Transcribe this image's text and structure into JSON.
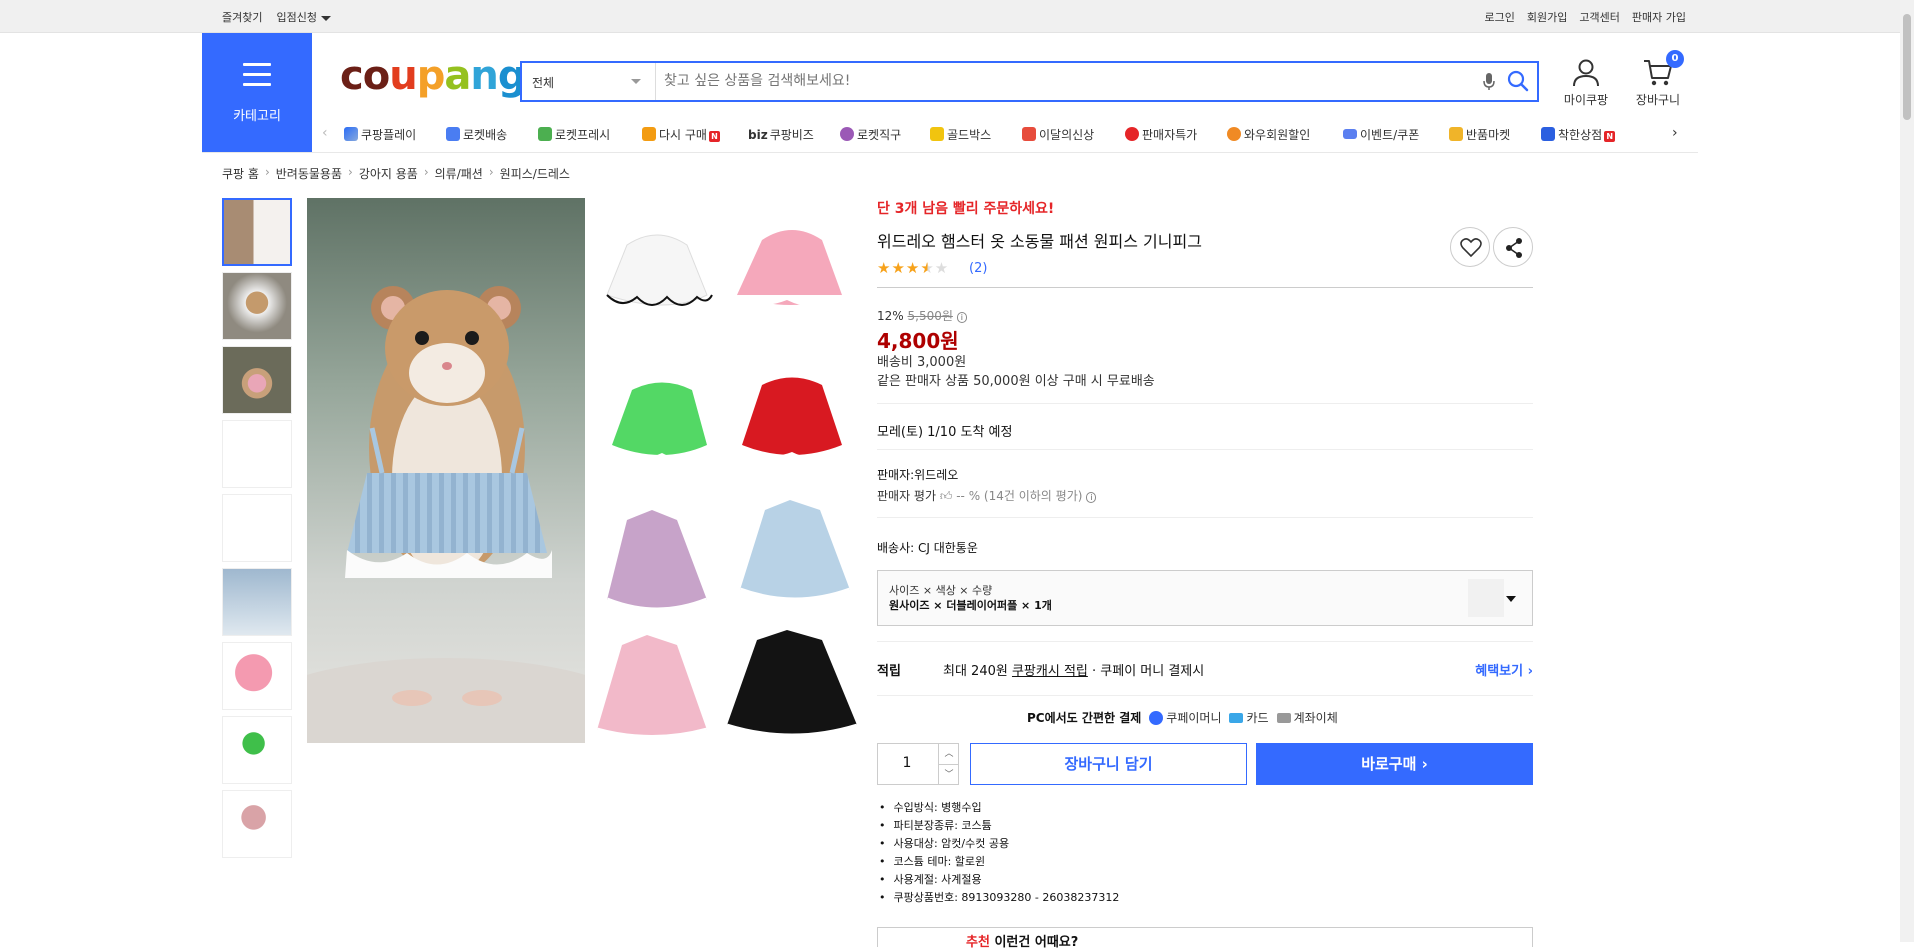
{
  "topbar": {
    "left": [
      "즐겨찾기",
      "입점신청"
    ],
    "right": [
      "로그인",
      "회원가입",
      "고객센터",
      "판매자 가입"
    ]
  },
  "category_label": "카테고리",
  "logo": [
    "c",
    "o",
    "u",
    "p",
    "a",
    "n",
    "g"
  ],
  "search": {
    "category": "전체",
    "placeholder": "찾고 싶은 상품을 검색해보세요!"
  },
  "header_actions": {
    "mycoupang": "마이쿠팡",
    "cart": "장바구니",
    "cart_count": "0"
  },
  "shortcuts": [
    "쿠팡플레이",
    "로켓배송",
    "로켓프레시",
    "다시 구매",
    "쿠팡비즈",
    "로켓직구",
    "골드박스",
    "이달의신상",
    "판매자특가",
    "와우회원할인",
    "이벤트/쿠폰",
    "반품마켓",
    "착한상점"
  ],
  "biz_prefix": "biz",
  "breadcrumb": [
    "쿠팡 홈",
    "반려동물용품",
    "강아지 용품",
    "의류/패션",
    "원피스/드레스"
  ],
  "product": {
    "low_stock": "단 3개 남음 빨리 주문하세요!",
    "title": "위드레오 햄스터 옷 소동물 패션 원피스 기니피그",
    "rating": 3.5,
    "review_count": "(2)",
    "discount": "12%",
    "original_price": "5,500원",
    "price": "4,800원",
    "shipping_fee": "배송비 3,000원",
    "free_shipping": "같은 판매자 상품 50,000원 이상 구매 시 무료배송",
    "arrival": "모레(토) 1/10 도착 예정",
    "seller": "판매자:위드레오",
    "seller_rating_label": "판매자 평가",
    "seller_rating_value": "-- % (14건 이하의 평가)",
    "carrier": "배송사:  CJ 대한통운",
    "option_header": "사이즈 × 색상 × 수량",
    "option_value": "원사이즈 × 더블레이어퍼플 × 1개",
    "reward_label": "적립",
    "reward_pre": "최대 240원 ",
    "reward_link": "쿠팡캐시 적립",
    "reward_post": " · 쿠페이 머니 결제시",
    "benefit": "혜택보기 ›",
    "pc_pay": "PC에서도 간편한 결제",
    "pay_methods": [
      "쿠페이머니",
      "카드",
      "계좌이체"
    ],
    "quantity": "1",
    "add_to_cart": "장바구니 담기",
    "buy_now": "바로구매 ›",
    "specs": [
      "수입방식: 병행수입",
      "파티분장종류: 코스튬",
      "사용대상: 암컷/수컷 공용",
      "코스튬 테마: 할로윈",
      "사용계절: 사계절용",
      "쿠팡상품번호: 8913093280 - 26038237312"
    ],
    "reco_em": "추천",
    "reco_rest": " 이런건 어때요?"
  },
  "colors": {
    "accent": "#346aff",
    "danger": "#e52528",
    "price": "#ae0000",
    "star": "#f7a21b"
  }
}
